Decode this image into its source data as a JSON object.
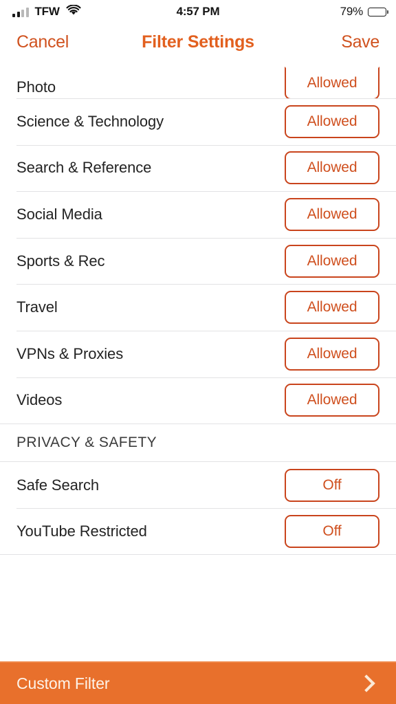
{
  "status_bar": {
    "carrier": "TFW",
    "time": "4:57 PM",
    "battery_percent": "79%",
    "signal_icon": "signal-bars-icon",
    "wifi_icon": "wifi-icon",
    "battery_icon": "battery-icon"
  },
  "nav": {
    "cancel_label": "Cancel",
    "title": "Filter Settings",
    "save_label": "Save"
  },
  "categories": {
    "rows": [
      {
        "label": "Photo",
        "value": "Allowed"
      },
      {
        "label": "Science & Technology",
        "value": "Allowed"
      },
      {
        "label": "Search & Reference",
        "value": "Allowed"
      },
      {
        "label": "Social Media",
        "value": "Allowed"
      },
      {
        "label": "Sports & Rec",
        "value": "Allowed"
      },
      {
        "label": "Travel",
        "value": "Allowed"
      },
      {
        "label": "VPNs & Proxies",
        "value": "Allowed"
      },
      {
        "label": "Videos",
        "value": "Allowed"
      }
    ]
  },
  "privacy_section": {
    "header": "PRIVACY & SAFETY",
    "rows": [
      {
        "label": "Safe Search",
        "value": "Off"
      },
      {
        "label": "YouTube Restricted",
        "value": "Off"
      }
    ]
  },
  "bottom_bar": {
    "label": "Custom Filter",
    "chevron_icon": "chevron-right-icon"
  },
  "colors": {
    "accent_orange": "#e2601f",
    "button_border": "#c9441c",
    "button_text": "#cf4f1e",
    "bottom_bar_bg": "#e8702c",
    "separator": "#e2e2e4",
    "row_text": "#232323"
  }
}
